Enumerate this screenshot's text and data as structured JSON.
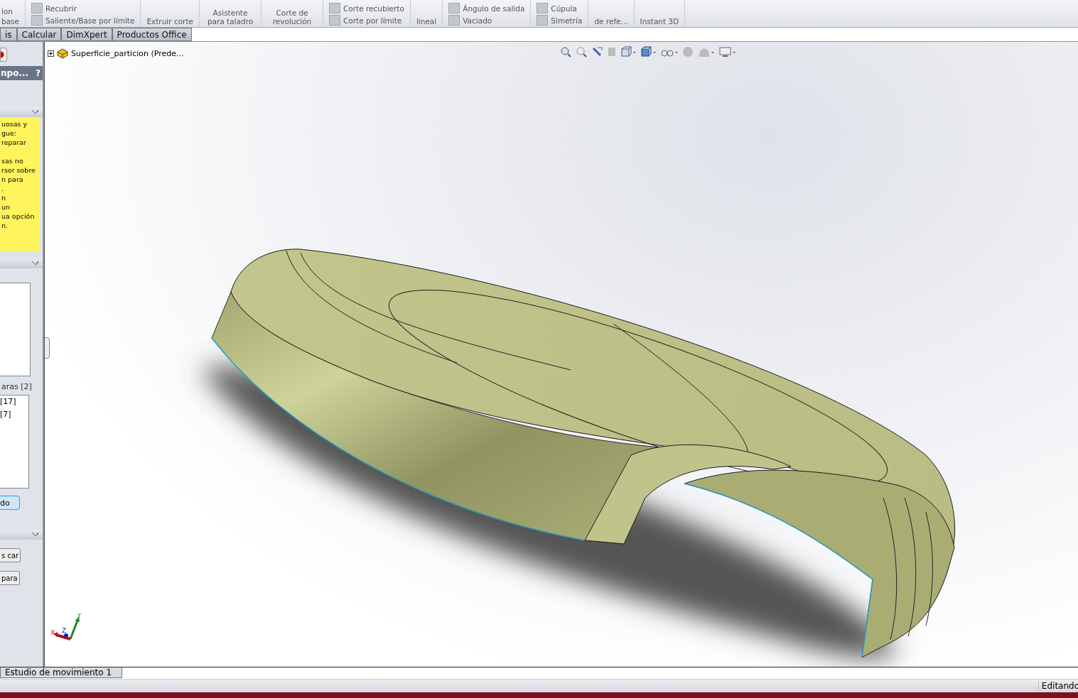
{
  "toolbar": {
    "groups": [
      {
        "items": [
          {
            "label": "ion",
            "icon": false
          },
          {
            "label": "base",
            "icon": false
          }
        ]
      },
      {
        "items": [
          {
            "label": "Recubrir",
            "icon": true
          },
          {
            "label": "Saliente/Base por límite",
            "icon": true
          }
        ]
      },
      {
        "items": [
          {
            "label": "Extruir corte",
            "icon": false
          }
        ]
      },
      {
        "items": [
          {
            "label": "Asistente para taladro",
            "icon": false
          }
        ]
      },
      {
        "items": [
          {
            "label": "Corte de revolución",
            "icon": false
          }
        ]
      },
      {
        "items": [
          {
            "label": "Corte recubierto",
            "icon": true
          },
          {
            "label": "Corte por límite",
            "icon": true
          }
        ]
      },
      {
        "items": [
          {
            "label": "lineal",
            "icon": false
          }
        ]
      },
      {
        "items": [
          {
            "label": "Ángulo de salida",
            "icon": true
          },
          {
            "label": "Vaciado",
            "icon": true
          }
        ]
      },
      {
        "items": [
          {
            "label": "Cúpula",
            "icon": true
          },
          {
            "label": "Simetría",
            "icon": true
          }
        ]
      },
      {
        "items": [
          {
            "label": "de refe...",
            "icon": false
          }
        ]
      },
      {
        "items": [
          {
            "label": "Instant 3D",
            "icon": false
          }
        ]
      }
    ]
  },
  "tabs": [
    {
      "label": "is",
      "selected": false
    },
    {
      "label": "Calcular",
      "selected": false
    },
    {
      "label": "DimXpert",
      "selected": false
    },
    {
      "label": "Productos Office",
      "selected": false
    }
  ],
  "panel": {
    "title": "npo...",
    "help": "?",
    "message": [
      [
        "uosas y",
        "gue:",
        "reparar"
      ],
      [
        "sas no",
        "rsor sobre",
        "n para",
        ".",
        "n",
        "un",
        "ua opción",
        "n."
      ]
    ],
    "bodies_label": "aras [2]",
    "bodies": [
      "[17]",
      "[7]"
    ],
    "action": "do",
    "buttons": [
      "s car",
      "para"
    ]
  },
  "tree": {
    "label": "Superficie_particion  (Prede..."
  },
  "triad": {
    "x": "X",
    "y": "Y",
    "z": "Z"
  },
  "bottom_tab": "Estudio de movimiento 1",
  "status": "Editando"
}
